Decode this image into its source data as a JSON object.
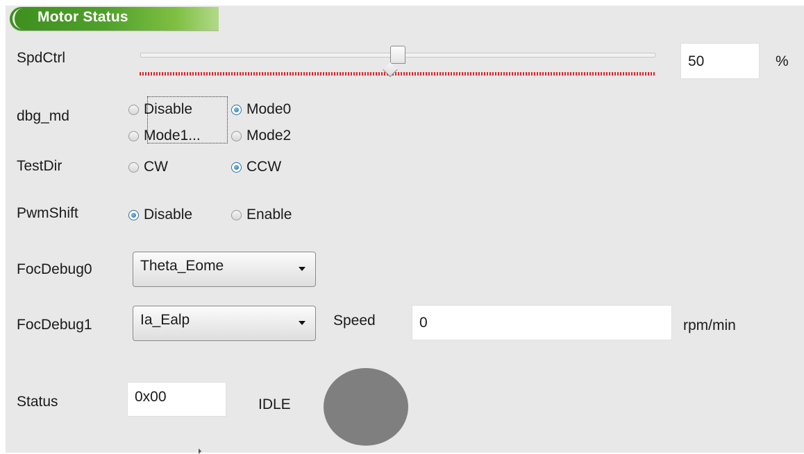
{
  "panel": {
    "title": "Motor Status"
  },
  "spdctrl": {
    "label": "SpdCtrl",
    "value": "50",
    "unit": "%",
    "slider_position_percent": 50
  },
  "dbg_md": {
    "label": "dbg_md",
    "options": [
      "Disable",
      "Mode0",
      "Mode1...",
      "Mode2"
    ],
    "selected": "Mode0"
  },
  "testdir": {
    "label": "TestDir",
    "options": [
      "CW",
      "CCW"
    ],
    "selected": "CCW"
  },
  "pwmshift": {
    "label": "PwmShift",
    "options": [
      "Disable",
      "Enable"
    ],
    "selected": "Disable"
  },
  "focdebug0": {
    "label": "FocDebug0",
    "value": "Theta_Eome"
  },
  "focdebug1": {
    "label": "FocDebug1",
    "value": "Ia_Ealp"
  },
  "speed": {
    "label": "Speed",
    "value": "0",
    "unit": "rpm/min"
  },
  "status": {
    "label": "Status",
    "value": "0x00",
    "state": "IDLE",
    "indicator_color": "#7f7f7f"
  },
  "colors": {
    "header_green": "#4fa02a",
    "tick_red": "#e0242a",
    "radio_blue": "#1a6ea6",
    "panel_bg": "#e8e8e8"
  }
}
